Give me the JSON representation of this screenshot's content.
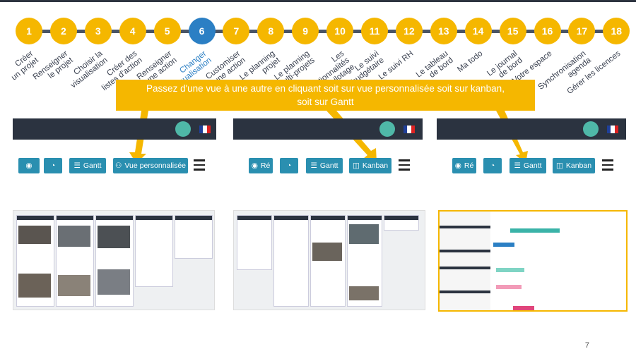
{
  "steps": [
    {
      "num": "1",
      "label": "Créer\nun projet"
    },
    {
      "num": "2",
      "label": "Renseigner\nle projet"
    },
    {
      "num": "3",
      "label": "Choisir la\nvisualisation"
    },
    {
      "num": "4",
      "label": "Créer des\nlistes d'action"
    },
    {
      "num": "5",
      "label": "Renseigner\nune action"
    },
    {
      "num": "6",
      "label": "Changer\nde visualisation"
    },
    {
      "num": "7",
      "label": "Customiser\nune action"
    },
    {
      "num": "8",
      "label": "Le planning\nprojet"
    },
    {
      "num": "9",
      "label": "Le planning\nmulti-projets"
    },
    {
      "num": "10",
      "label": "Les\nfonctionnalités\nde pilotage"
    },
    {
      "num": "11",
      "label": "Le suivi\nbudgétaire"
    },
    {
      "num": "12",
      "label": "Le suivi RH"
    },
    {
      "num": "13",
      "label": "Le tableau\nde bord"
    },
    {
      "num": "14",
      "label": "Ma todo"
    },
    {
      "num": "15",
      "label": "Le journal\nde bord"
    },
    {
      "num": "16",
      "label": "Votre espace"
    },
    {
      "num": "17",
      "label": "Synchronisation\nagenda"
    },
    {
      "num": "18",
      "label": "Gérer les licences"
    }
  ],
  "active_step": "6",
  "callout": {
    "line1": "Passez d'une vue à une autre  en cliquant soit sur vue personnalisée soit sur kanban,",
    "line2": "soit sur Gantt"
  },
  "panel1": {
    "gantt_label": "Gantt",
    "custom_label": "Vue personnalisée"
  },
  "panel2": {
    "re_label": "Ré",
    "gantt_label": "Gantt",
    "kanban_label": "Kanban"
  },
  "panel3": {
    "re_label": "Ré",
    "gantt_label": "Gantt",
    "kanban_label": "Kanban"
  },
  "page_number": "7",
  "colors": {
    "accent": "#f5b700",
    "active": "#2b7fc4",
    "button": "#2a8fb0",
    "appbar": "#2b3340"
  }
}
